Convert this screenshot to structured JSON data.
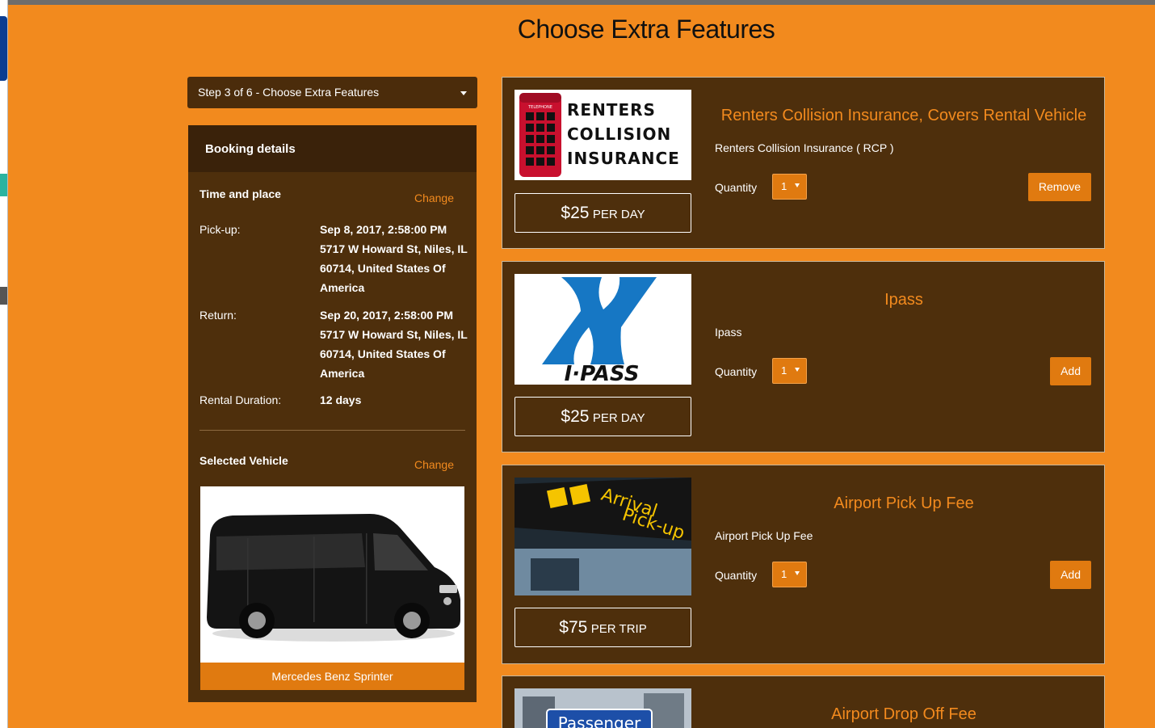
{
  "page": {
    "title": "Choose Extra Features"
  },
  "step": {
    "label": "Step 3 of 6 - Choose Extra Features"
  },
  "booking": {
    "heading": "Booking details",
    "time_place": {
      "title": "Time and place",
      "change": "Change",
      "pickup_label": "Pick-up:",
      "pickup_value": "Sep 8, 2017, 2:58:00 PM 5717 W Howard St, Niles, IL 60714, United States Of America",
      "return_label": "Return:",
      "return_value": "Sep 20, 2017, 2:58:00 PM 5717 W Howard St, Niles, IL 60714, United States Of America",
      "duration_label": "Rental Duration:",
      "duration_value": "12 days"
    },
    "vehicle": {
      "title": "Selected Vehicle",
      "change": "Change",
      "name": "Mercedes Benz Sprinter"
    }
  },
  "features": [
    {
      "title": "Renters Collision Insurance, Covers Rental Vehicle",
      "description": "Renters Collision Insurance ( RCP )",
      "thumb_text": "RENTERS COLLISION INSURANCE",
      "thumb_small": "TELEPHONE",
      "price_currency": "$",
      "price_amount": "25",
      "price_unit": "PER DAY",
      "quantity_label": "Quantity",
      "quantity": "1",
      "action": "Remove"
    },
    {
      "title": "Ipass",
      "description": "Ipass",
      "thumb_text": "I·PASS",
      "price_currency": "$",
      "price_amount": "25",
      "price_unit": "PER DAY",
      "quantity_label": "Quantity",
      "quantity": "1",
      "action": "Add"
    },
    {
      "title": "Airport Pick Up Fee",
      "description": "Airport Pick Up Fee",
      "thumb_text": "Arrival Pick-up",
      "price_currency": "$",
      "price_amount": "75",
      "price_unit": "PER TRIP",
      "quantity_label": "Quantity",
      "quantity": "1",
      "action": "Add"
    },
    {
      "title": "Airport Drop Off Fee",
      "thumb_text": "Passenger"
    }
  ],
  "colors": {
    "background": "#f28a1e",
    "panel": "#4e2f0c",
    "accent": "#e07a10"
  }
}
